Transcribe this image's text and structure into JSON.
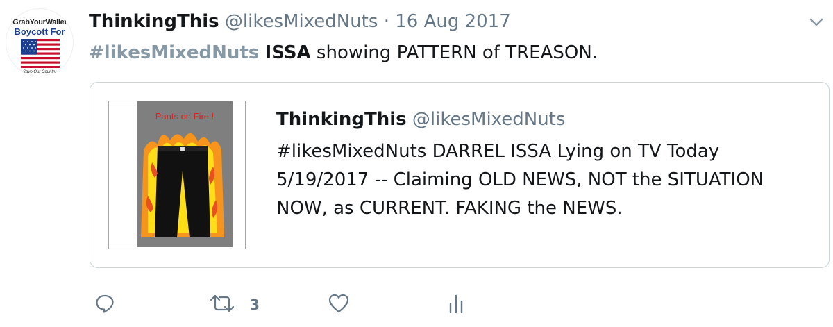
{
  "avatar": {
    "top_text": "GrabYourWallet",
    "mid_text": "Boycott For",
    "bottom_text": "Save Our Country"
  },
  "tweet": {
    "display_name": "ThinkingThis",
    "handle": "@likesMixedNuts",
    "separator": "·",
    "date": "16 Aug 2017",
    "hashtag": "#likesMixedNuts",
    "bold_word": "ISSA",
    "text_rest": "showing PATTERN of TREASON."
  },
  "quoted": {
    "display_name": "ThinkingThis",
    "handle": "@likesMixedNuts",
    "image_caption": "Pants on Fire !",
    "lines": [
      "#likesMixedNuts DARREL ISSA Lying on TV Today",
      "5/19/2017 -- Claiming OLD NEWS,  NOT the SITUATION",
      "NOW, as CURRENT. FAKING the NEWS."
    ]
  },
  "actions": {
    "reply_icon": "reply-icon",
    "retweet_icon": "retweet-icon",
    "retweet_count": "3",
    "like_icon": "heart-icon",
    "analytics_icon": "analytics-icon"
  },
  "colors": {
    "text": "#14171a",
    "secondary": "#657786",
    "hashtag": "#8899a6",
    "border": "#ccd6dd"
  }
}
